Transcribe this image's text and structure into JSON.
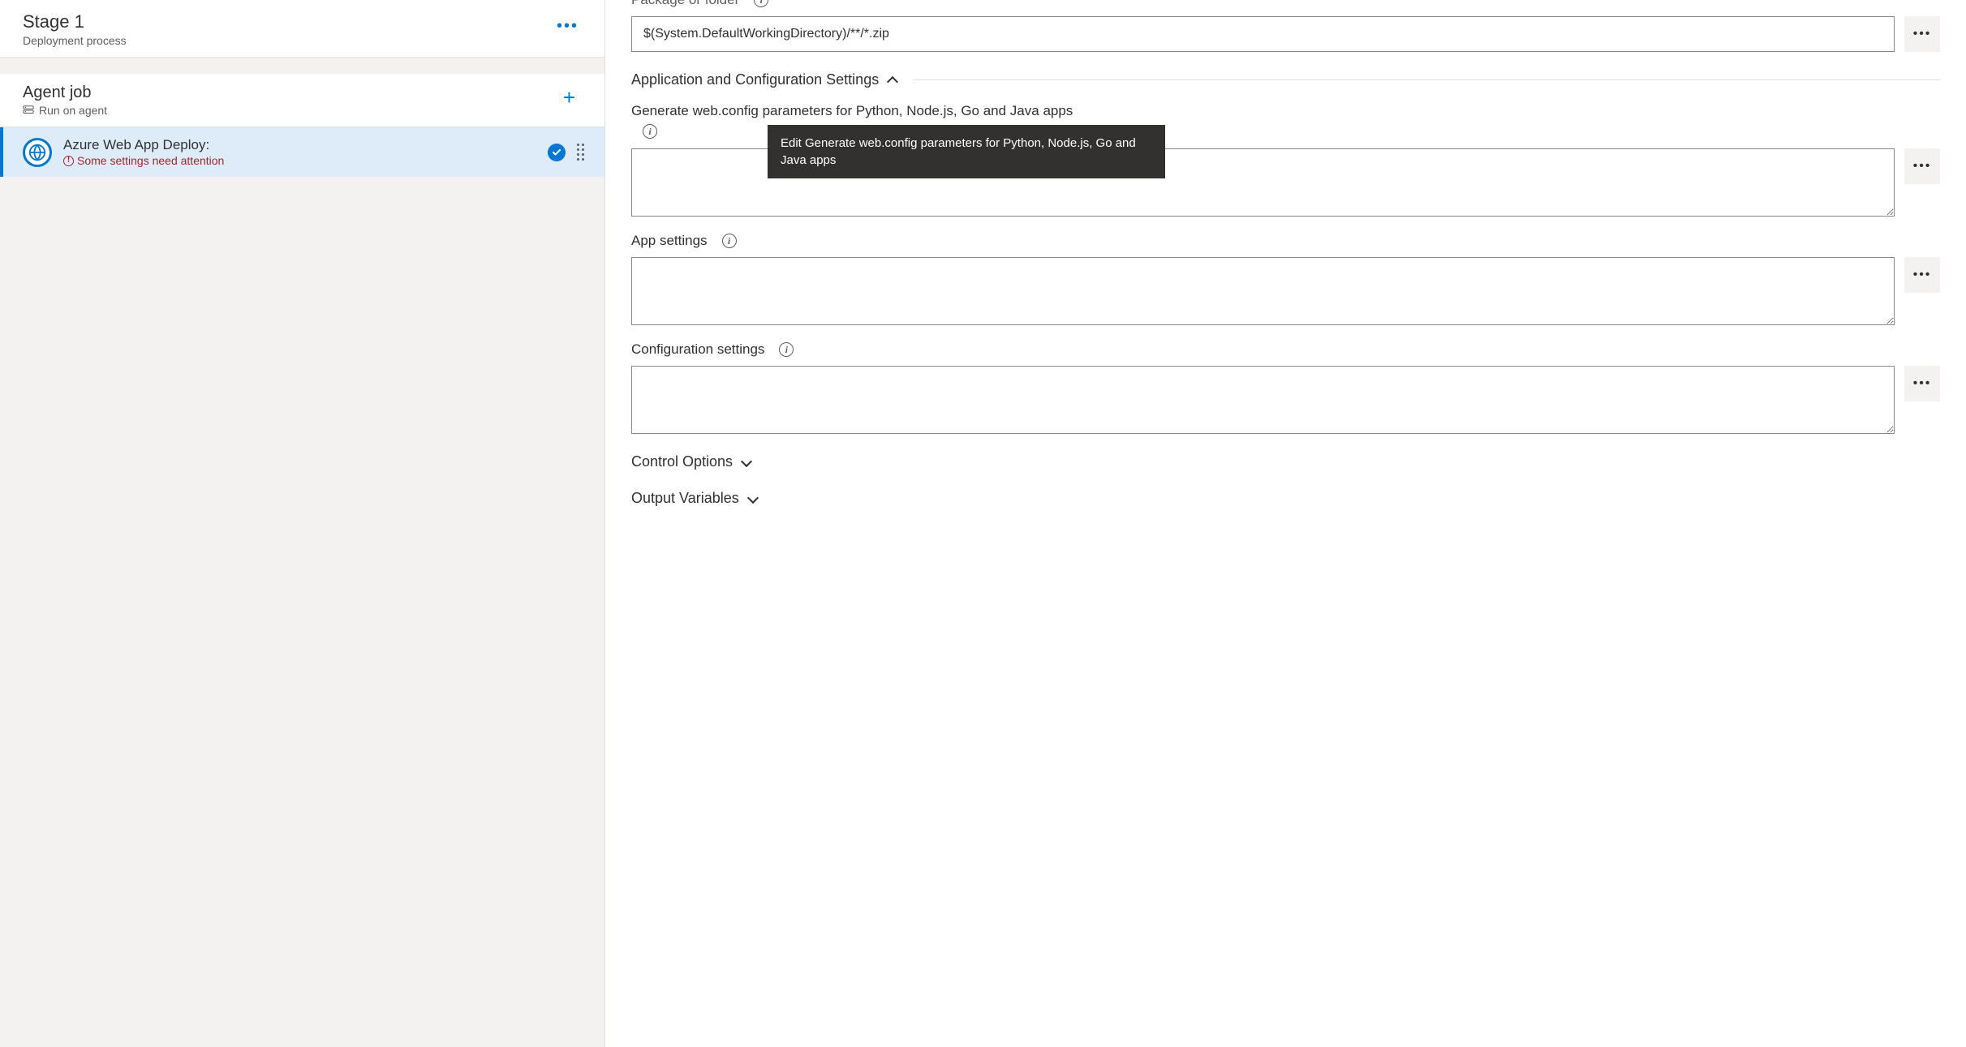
{
  "stage": {
    "title": "Stage 1",
    "subtitle": "Deployment process"
  },
  "agentJob": {
    "title": "Agent job",
    "subtitle": "Run on agent"
  },
  "task": {
    "title": "Azure Web App Deploy:",
    "warning": "Some settings need attention"
  },
  "form": {
    "packageLabel": "Package or folder",
    "packageValue": "$(System.DefaultWorkingDirectory)/**/*.zip",
    "appConfigSection": "Application and Configuration Settings",
    "genWebConfigLabel": "Generate web.config parameters for Python, Node.js, Go and Java apps",
    "genWebConfigValue": "",
    "appSettingsLabel": "App settings",
    "appSettingsValue": "",
    "configSettingsLabel": "Configuration settings",
    "configSettingsValue": "",
    "controlOptions": "Control Options",
    "outputVariables": "Output Variables"
  },
  "tooltip": {
    "text": "Edit Generate web.config parameters for Python, Node.js, Go and Java apps"
  }
}
